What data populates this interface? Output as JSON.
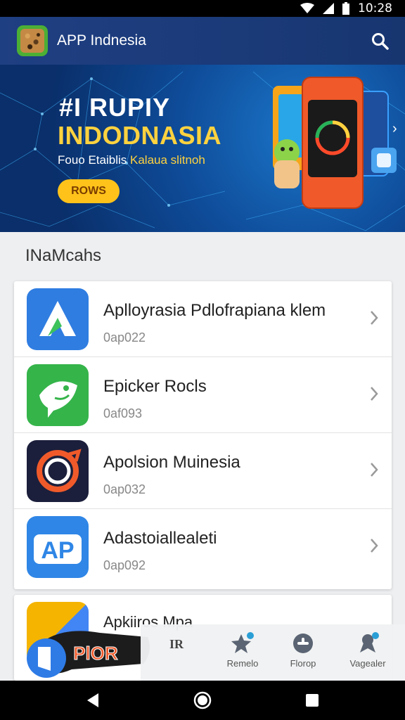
{
  "status_bar": {
    "time": "10:28"
  },
  "app_bar": {
    "title": "APP Indnesia"
  },
  "banner": {
    "line1": "#I RUPIY",
    "line2": "INDODNASIA",
    "subtitle_a": "Fouo Etaiblis",
    "subtitle_b": "Kalaua slitnoh",
    "cta_label": "ROWS"
  },
  "section": {
    "title": "INaMcahs"
  },
  "apps": [
    {
      "name": "Aplloyrasia Pdlofrapiana klem",
      "sub": "0ap022",
      "icon": "delta-a-icon",
      "color": "#2f7de1"
    },
    {
      "name": "Epicker Rocls",
      "sub": "0af093",
      "icon": "fish-icon",
      "color": "#35b44a"
    },
    {
      "name": "Apolsion Muinesia",
      "sub": "0ap032",
      "icon": "swirl-icon",
      "color": "#1b1f3b"
    },
    {
      "name": "Adastoiallealeti",
      "sub": "0ap092",
      "icon": "ap-icon",
      "color": "#2f86e6"
    }
  ],
  "partial_app": {
    "name": "Apkiiros Mpa",
    "icon": "colorful-icon"
  },
  "sticker": {
    "text": "PlOR"
  },
  "bottom_nav": [
    {
      "label": "",
      "icon": "logo-mark-icon"
    },
    {
      "label": "Remelo",
      "icon": "star-icon"
    },
    {
      "label": "Florop",
      "icon": "gamepad-icon"
    },
    {
      "label": "Vagealer",
      "icon": "badge-icon"
    }
  ],
  "bottom_nav_logo_text": "IR",
  "system_nav": {
    "back": "back",
    "home": "home",
    "recents": "recents"
  }
}
